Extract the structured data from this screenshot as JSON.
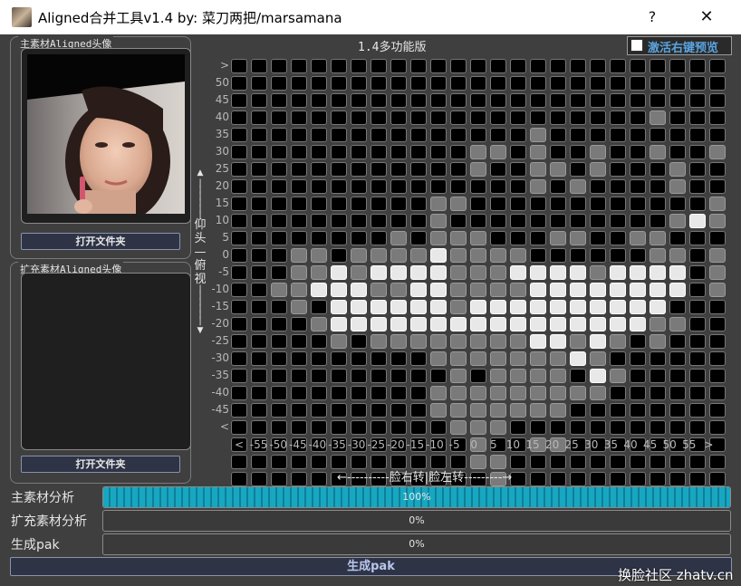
{
  "window": {
    "title": "Aligned合并工具v1.4  by: 菜刀两把/marsamana",
    "help_label": "?",
    "close_label": "✕"
  },
  "main_panel": {
    "title": "主素材Aligned头像",
    "open_button": "打开文件夹"
  },
  "ext_panel": {
    "title": "扩充素材Aligned头像",
    "open_button": "打开文件夹"
  },
  "version_label": "1.4多功能版",
  "preview_checkbox": {
    "label": "激活右键预览",
    "checked": false
  },
  "grid": {
    "y_labels": [
      ">",
      "50",
      "45",
      "40",
      "35",
      "30",
      "25",
      "20",
      "15",
      "10",
      "5",
      "0",
      "-5",
      "-10",
      "-15",
      "-20",
      "-25",
      "-30",
      "-35",
      "-40",
      "-45",
      "<"
    ],
    "x_labels": [
      "<",
      "-55",
      "-50",
      "-45",
      "-40",
      "-35",
      "-30",
      "-25",
      "-20",
      "-15",
      "-10",
      "-5",
      "0",
      "5",
      "10",
      "15",
      "20",
      "25",
      "30",
      "35",
      "40",
      "45",
      "50",
      "55",
      ">"
    ],
    "vertical_axis_label": "仰头—俯视",
    "horizontal_axis_label": "←----------脸右转|脸左转---------→",
    "rows": [
      "0000000000000000000000000",
      "0000000000000000000000000",
      "0000000000000000000000000",
      "0000000000000000000001000",
      "0000000000000001000000000",
      "0000000000001101001001001",
      "0000000000001001101000100",
      "0000000000000001010000100",
      "0000000000110000000000001",
      "0000000000100000000000121",
      "0000000010111000110011000",
      "0001101111211110000001101",
      "0001121222211122221222201",
      "0011222112211112222222201",
      "0001022222212222222222000",
      "0000122222222222222221100",
      "0000010111111112212101000",
      "0000000000111111121000000",
      "0000000000010111102100000",
      "0000000000111111111000000",
      "0000000000111111100000000",
      "0000000000011100000000000",
      "0000000000001001100000000",
      "0000000000001100000000000",
      "0000000000000100000000000"
    ]
  },
  "progress": [
    {
      "label": "主素材分析",
      "percent": 100,
      "text": "100%"
    },
    {
      "label": "扩充素材分析",
      "percent": 0,
      "text": "0%"
    },
    {
      "label": "生成pak",
      "percent": 0,
      "text": "0%"
    }
  ],
  "generate_button": "生成pak",
  "watermark": "换脸社区 zhatv.cn"
}
